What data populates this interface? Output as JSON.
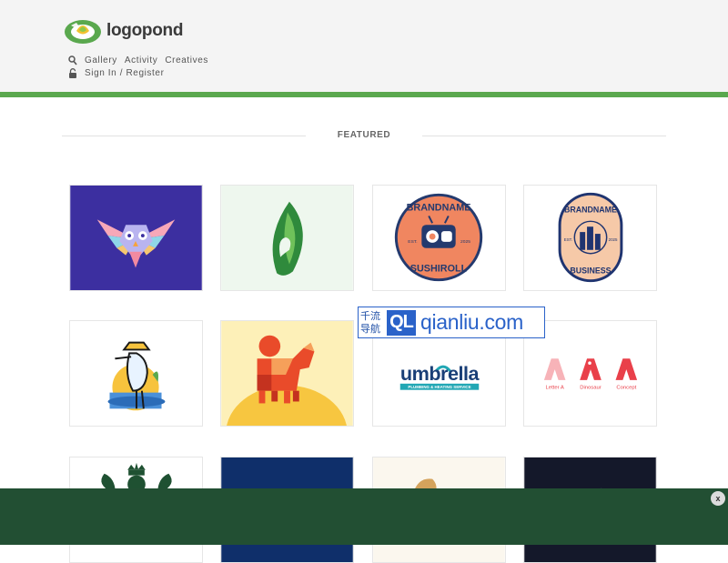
{
  "header": {
    "logo_text": "logopond",
    "nav": {
      "gallery": "Gallery",
      "activity": "Activity",
      "creatives": "Creatives",
      "signin": "Sign In / Register"
    }
  },
  "section": {
    "title": "FEATURED"
  },
  "tiles": [
    {
      "text": []
    },
    {
      "text": []
    },
    {
      "text": [
        "BRANDNAME",
        "SUSHIROLL",
        "EST.",
        "2025"
      ]
    },
    {
      "text": [
        "BRANDNAME",
        "BUSINESS",
        "EST.",
        "2025"
      ]
    },
    {
      "text": []
    },
    {
      "text": []
    },
    {
      "text": [
        "umbrella",
        "PLUMBING & HEATING SERVICE"
      ]
    },
    {
      "text": [
        "Letter A",
        "Dinosaur",
        "Concept"
      ]
    }
  ],
  "watermark": {
    "cn_top": "千流",
    "cn_bottom": "导航",
    "box": "QL",
    "url": "qianliu.com"
  },
  "banner": {
    "close_label": "x"
  },
  "colors": {
    "brand_green": "#5aa84e",
    "banner_green": "#224f33",
    "watermark_blue": "#2a62c9"
  }
}
